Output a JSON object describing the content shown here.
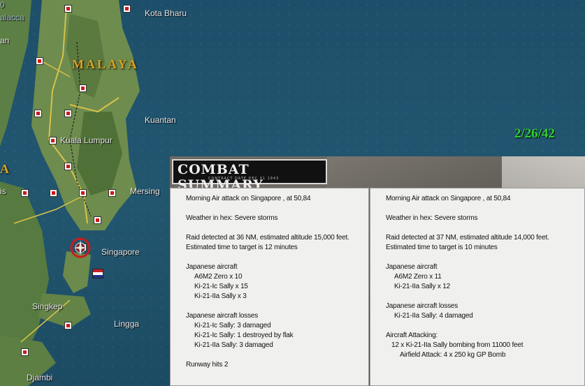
{
  "map": {
    "date": "2/26/42",
    "region_labels": [
      "MALAYA",
      "A"
    ],
    "places": [
      "Kota Bharu",
      "Kuantan",
      "Kuala Lumpur",
      "Mersing",
      "Singapore",
      "Singkep",
      "Lingga",
      "Djambi",
      "alacca",
      "an",
      "is"
    ],
    "corner_text": "0"
  },
  "combat_summary": {
    "title": "COMBAT SUMMARY",
    "subtitle": "CONTRACT DATE DEC 31 1943",
    "left_report": [
      "Morning Air attack on Singapore , at 50,84",
      "",
      "Weather in hex: Severe storms",
      "",
      "Raid detected at 36 NM, estimated altitude 15,000 feet.",
      "Estimated time to target is 12 minutes",
      "",
      "Japanese aircraft",
      "   A6M2 Zero x 10",
      "   Ki-21-Ic Sally x 15",
      "   Ki-21-IIa Sally x 3",
      "",
      "Japanese aircraft losses",
      "   Ki-21-Ic Sally: 3 damaged",
      "   Ki-21-Ic Sally: 1 destroyed by flak",
      "   Ki-21-IIa Sally: 3 damaged",
      "",
      "Runway hits 2"
    ],
    "right_report": [
      "Morning Air attack on Singapore , at 50,84",
      "",
      "Weather in hex: Severe storms",
      "",
      "Raid detected at 37 NM, estimated altitude 14,000 feet.",
      "Estimated time to target is 10 minutes",
      "",
      "Japanese aircraft",
      "   A6M2 Zero x 11",
      "   Ki-21-IIa Sally x 12",
      "",
      "Japanese aircraft losses",
      "   Ki-21-IIa Sally: 4 damaged",
      "",
      "Aircraft Attacking:",
      "  12 x Ki-21-IIa Sally bombing from 11000 feet",
      "     Airfield Attack:  4 x 250 kg GP Bomb"
    ]
  },
  "colors": {
    "date": "#2fd12f",
    "region": "#d9a223",
    "town_marker": "#d01818"
  },
  "icons": [
    "town-marker-icon",
    "airbase-target-icon",
    "dutch-flag-icon"
  ]
}
